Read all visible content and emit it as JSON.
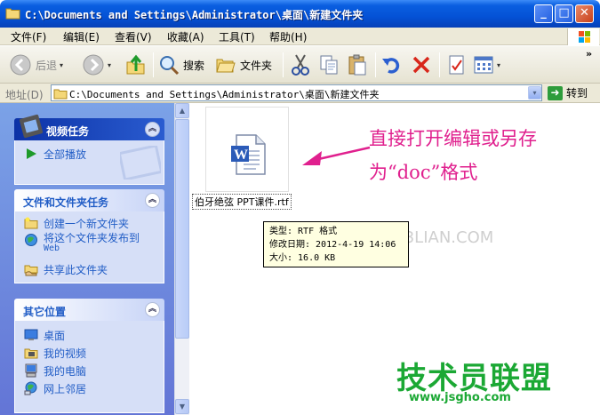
{
  "window": {
    "title": "C:\\Documents and Settings\\Administrator\\桌面\\新建文件夹",
    "min_glyph": "_",
    "max_glyph": "□",
    "close_glyph": "✕"
  },
  "menu": [
    "文件(F)",
    "编辑(E)",
    "查看(V)",
    "收藏(A)",
    "工具(T)",
    "帮助(H)"
  ],
  "toolbar": {
    "back_label": "后退",
    "search_label": "搜索",
    "folders_label": "文件夹",
    "dropdown_glyph": "▾",
    "overflow_glyph": "»"
  },
  "address": {
    "label": "地址(D)",
    "value": "C:\\Documents and Settings\\Administrator\\桌面\\新建文件夹",
    "dropdown_glyph": "▾",
    "go_glyph": "➜",
    "go_label": "转到"
  },
  "task_pane": {
    "video_tasks": {
      "title": "视频任务",
      "items": [
        {
          "label": "全部播放",
          "icon": "play-icon"
        }
      ]
    },
    "file_tasks": {
      "title": "文件和文件夹任务",
      "items": [
        {
          "label": "创建一个新文件夹",
          "icon": "new-folder-icon"
        },
        {
          "label": "将这个文件夹发布到",
          "sub": "Web",
          "icon": "publish-web-icon"
        },
        {
          "label": "共享此文件夹",
          "icon": "share-folder-icon"
        }
      ]
    },
    "other_places": {
      "title": "其它位置",
      "items": [
        {
          "label": "桌面",
          "icon": "desktop-icon"
        },
        {
          "label": "我的视频",
          "icon": "my-videos-icon"
        },
        {
          "label": "我的电脑",
          "icon": "my-computer-icon"
        },
        {
          "label": "网上邻居",
          "icon": "network-icon"
        }
      ]
    },
    "collapse_glyph": "︽"
  },
  "scrollbar": {
    "up_glyph": "▲",
    "down_glyph": "▼"
  },
  "file": {
    "name": "伯牙绝弦 PPT课件.rtf",
    "tooltip": {
      "type": "类型: RTF 格式",
      "modified": "修改日期: 2012-4-19 14:06",
      "size": "大小: 16.0 KB"
    }
  },
  "annotation": {
    "line1": "直接打开编辑或另存",
    "line2": "为“doc”格式"
  },
  "watermarks": {
    "top": "三联网 3LIAN.COM",
    "brand": "技术员联盟",
    "url": "www.jsgho.com"
  },
  "colors": {
    "titlebar": "#0452d6",
    "taskpane": "#6f8fdd",
    "link": "#215dc6",
    "annotation": "#e0208e",
    "watermark_green": "#1ba834"
  }
}
